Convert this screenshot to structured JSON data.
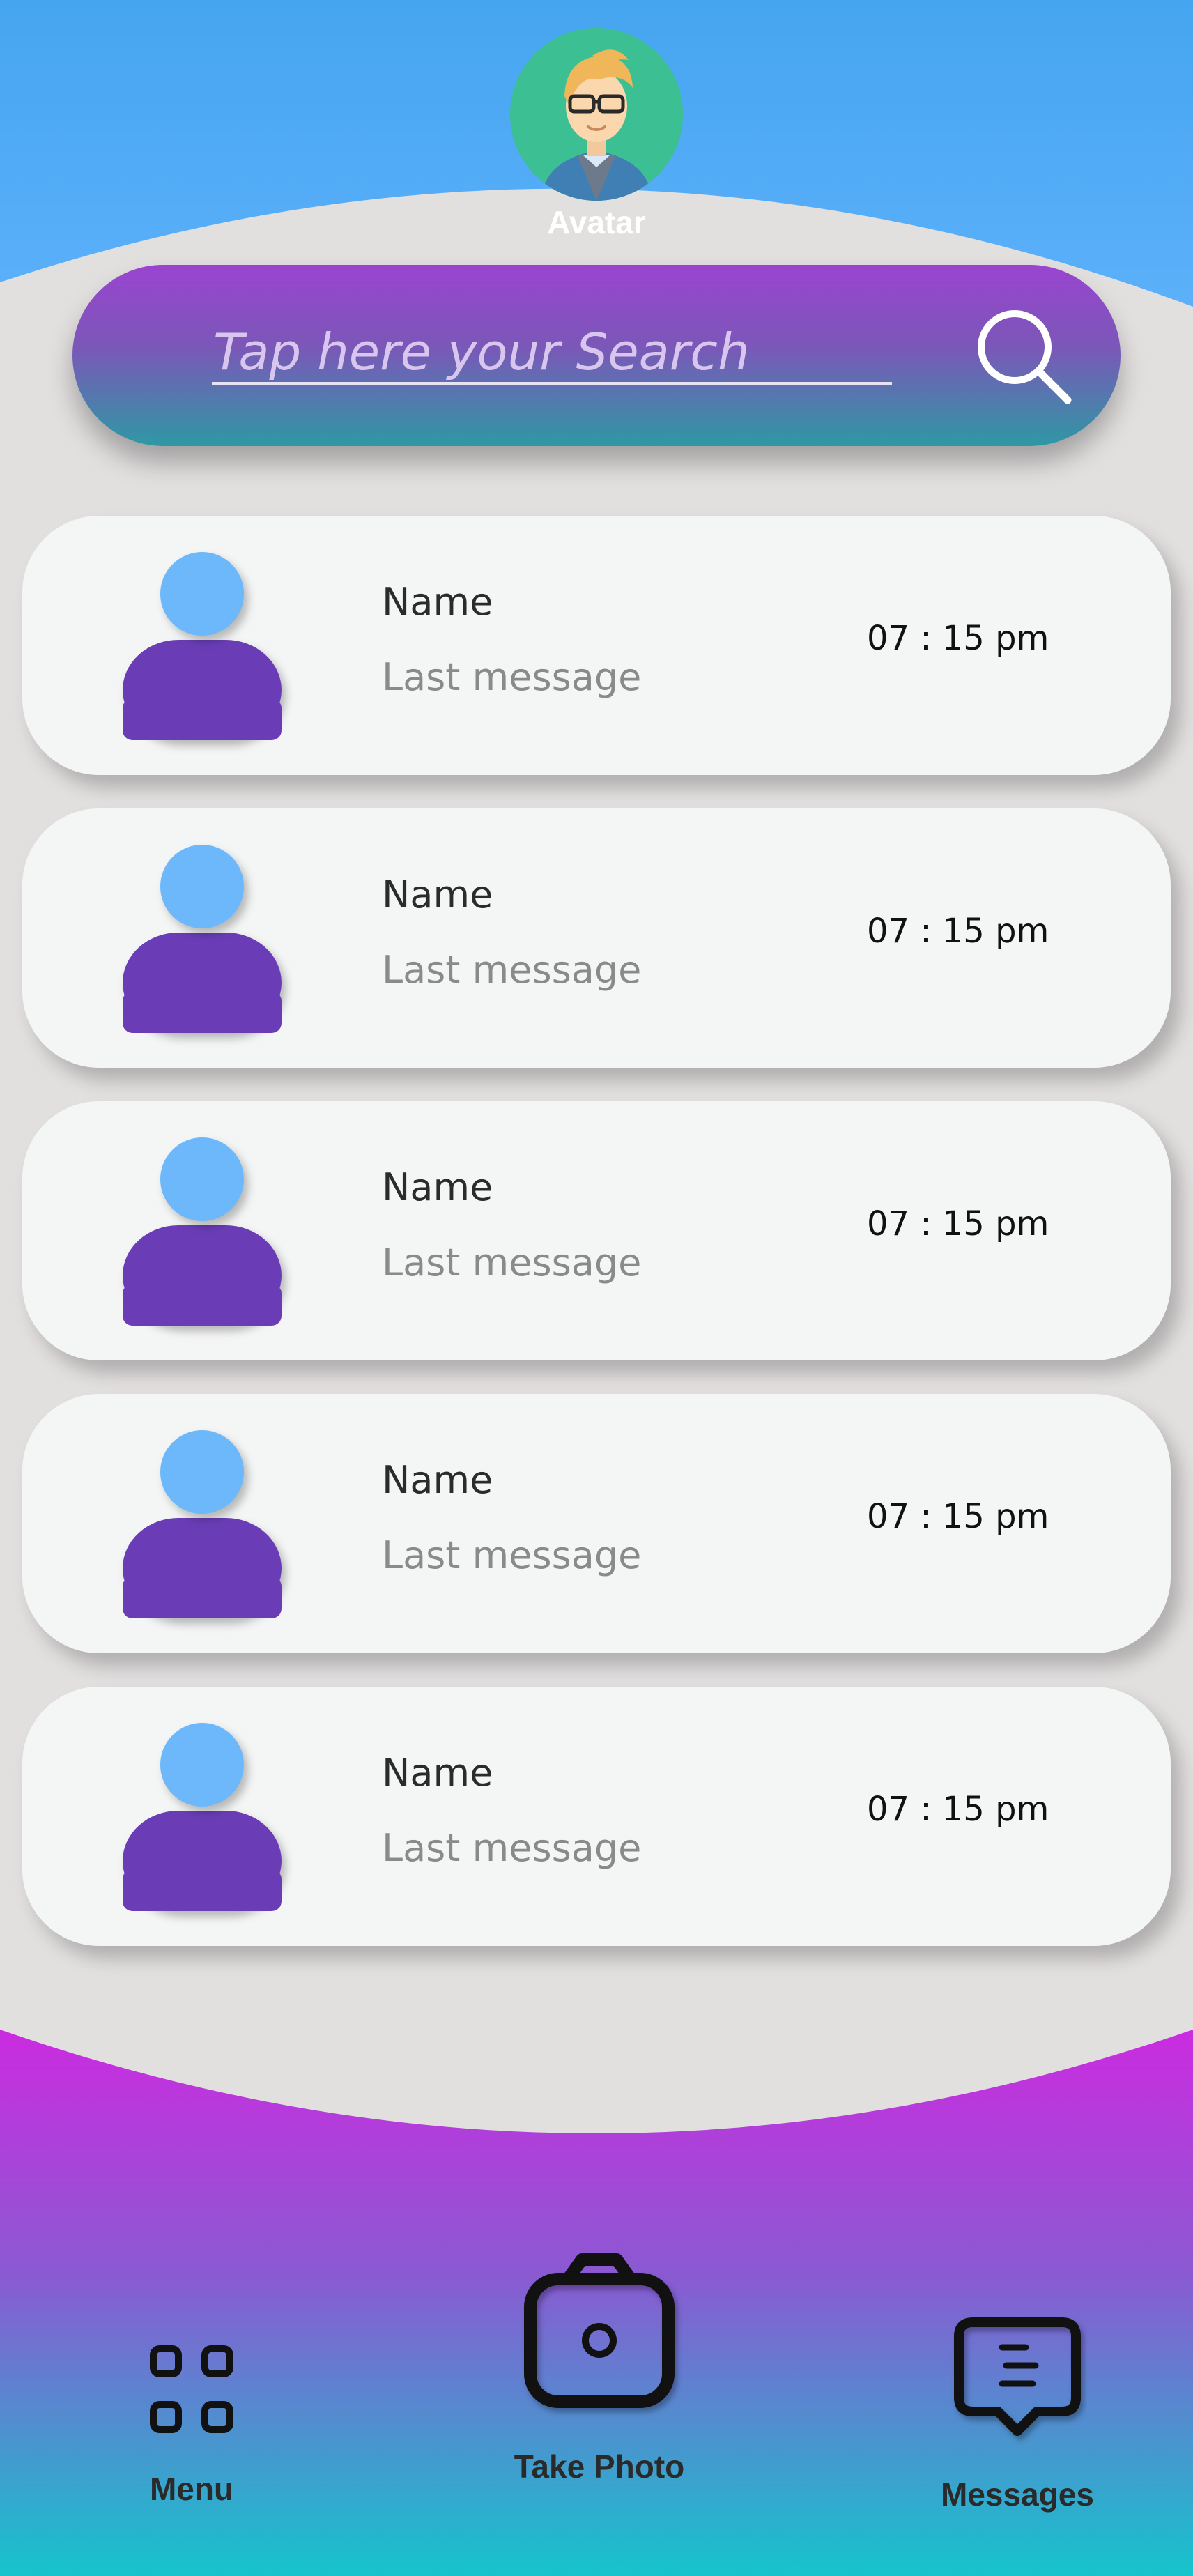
{
  "header": {
    "avatar_label": "Avatar",
    "colors": {
      "top_light": "#5aaef8",
      "top_dark": "#4aa8f0"
    }
  },
  "search": {
    "placeholder": "Tap here your Search",
    "value": "",
    "icon": "search-icon"
  },
  "chats": [
    {
      "name": "Name",
      "last_message": "Last message",
      "time": "07 : 15 pm",
      "avatar_icon": "person-icon"
    },
    {
      "name": "Name",
      "last_message": "Last message",
      "time": "07 : 15 pm",
      "avatar_icon": "person-icon"
    },
    {
      "name": "Name",
      "last_message": "Last message",
      "time": "07 : 15 pm",
      "avatar_icon": "person-icon"
    },
    {
      "name": "Name",
      "last_message": "Last message",
      "time": "07 : 15 pm",
      "avatar_icon": "person-icon"
    },
    {
      "name": "Name",
      "last_message": "Last message",
      "time": "07 : 15 pm",
      "avatar_icon": "person-icon"
    }
  ],
  "bottom_nav": {
    "menu": {
      "label": "Menu",
      "icon": "grid-icon"
    },
    "take_photo": {
      "label": "Take Photo",
      "icon": "camera-icon"
    },
    "messages": {
      "label": "Messages",
      "icon": "message-icon"
    },
    "colors": {
      "top": "#c92ee0",
      "mid": "#8a5ad2",
      "bottom": "#17c3cc"
    }
  },
  "theme": {
    "background": "#e2dfdf",
    "card": "#f4f5f5",
    "avatar_head": "#6cb8fa",
    "avatar_body": "#6a3db6"
  }
}
